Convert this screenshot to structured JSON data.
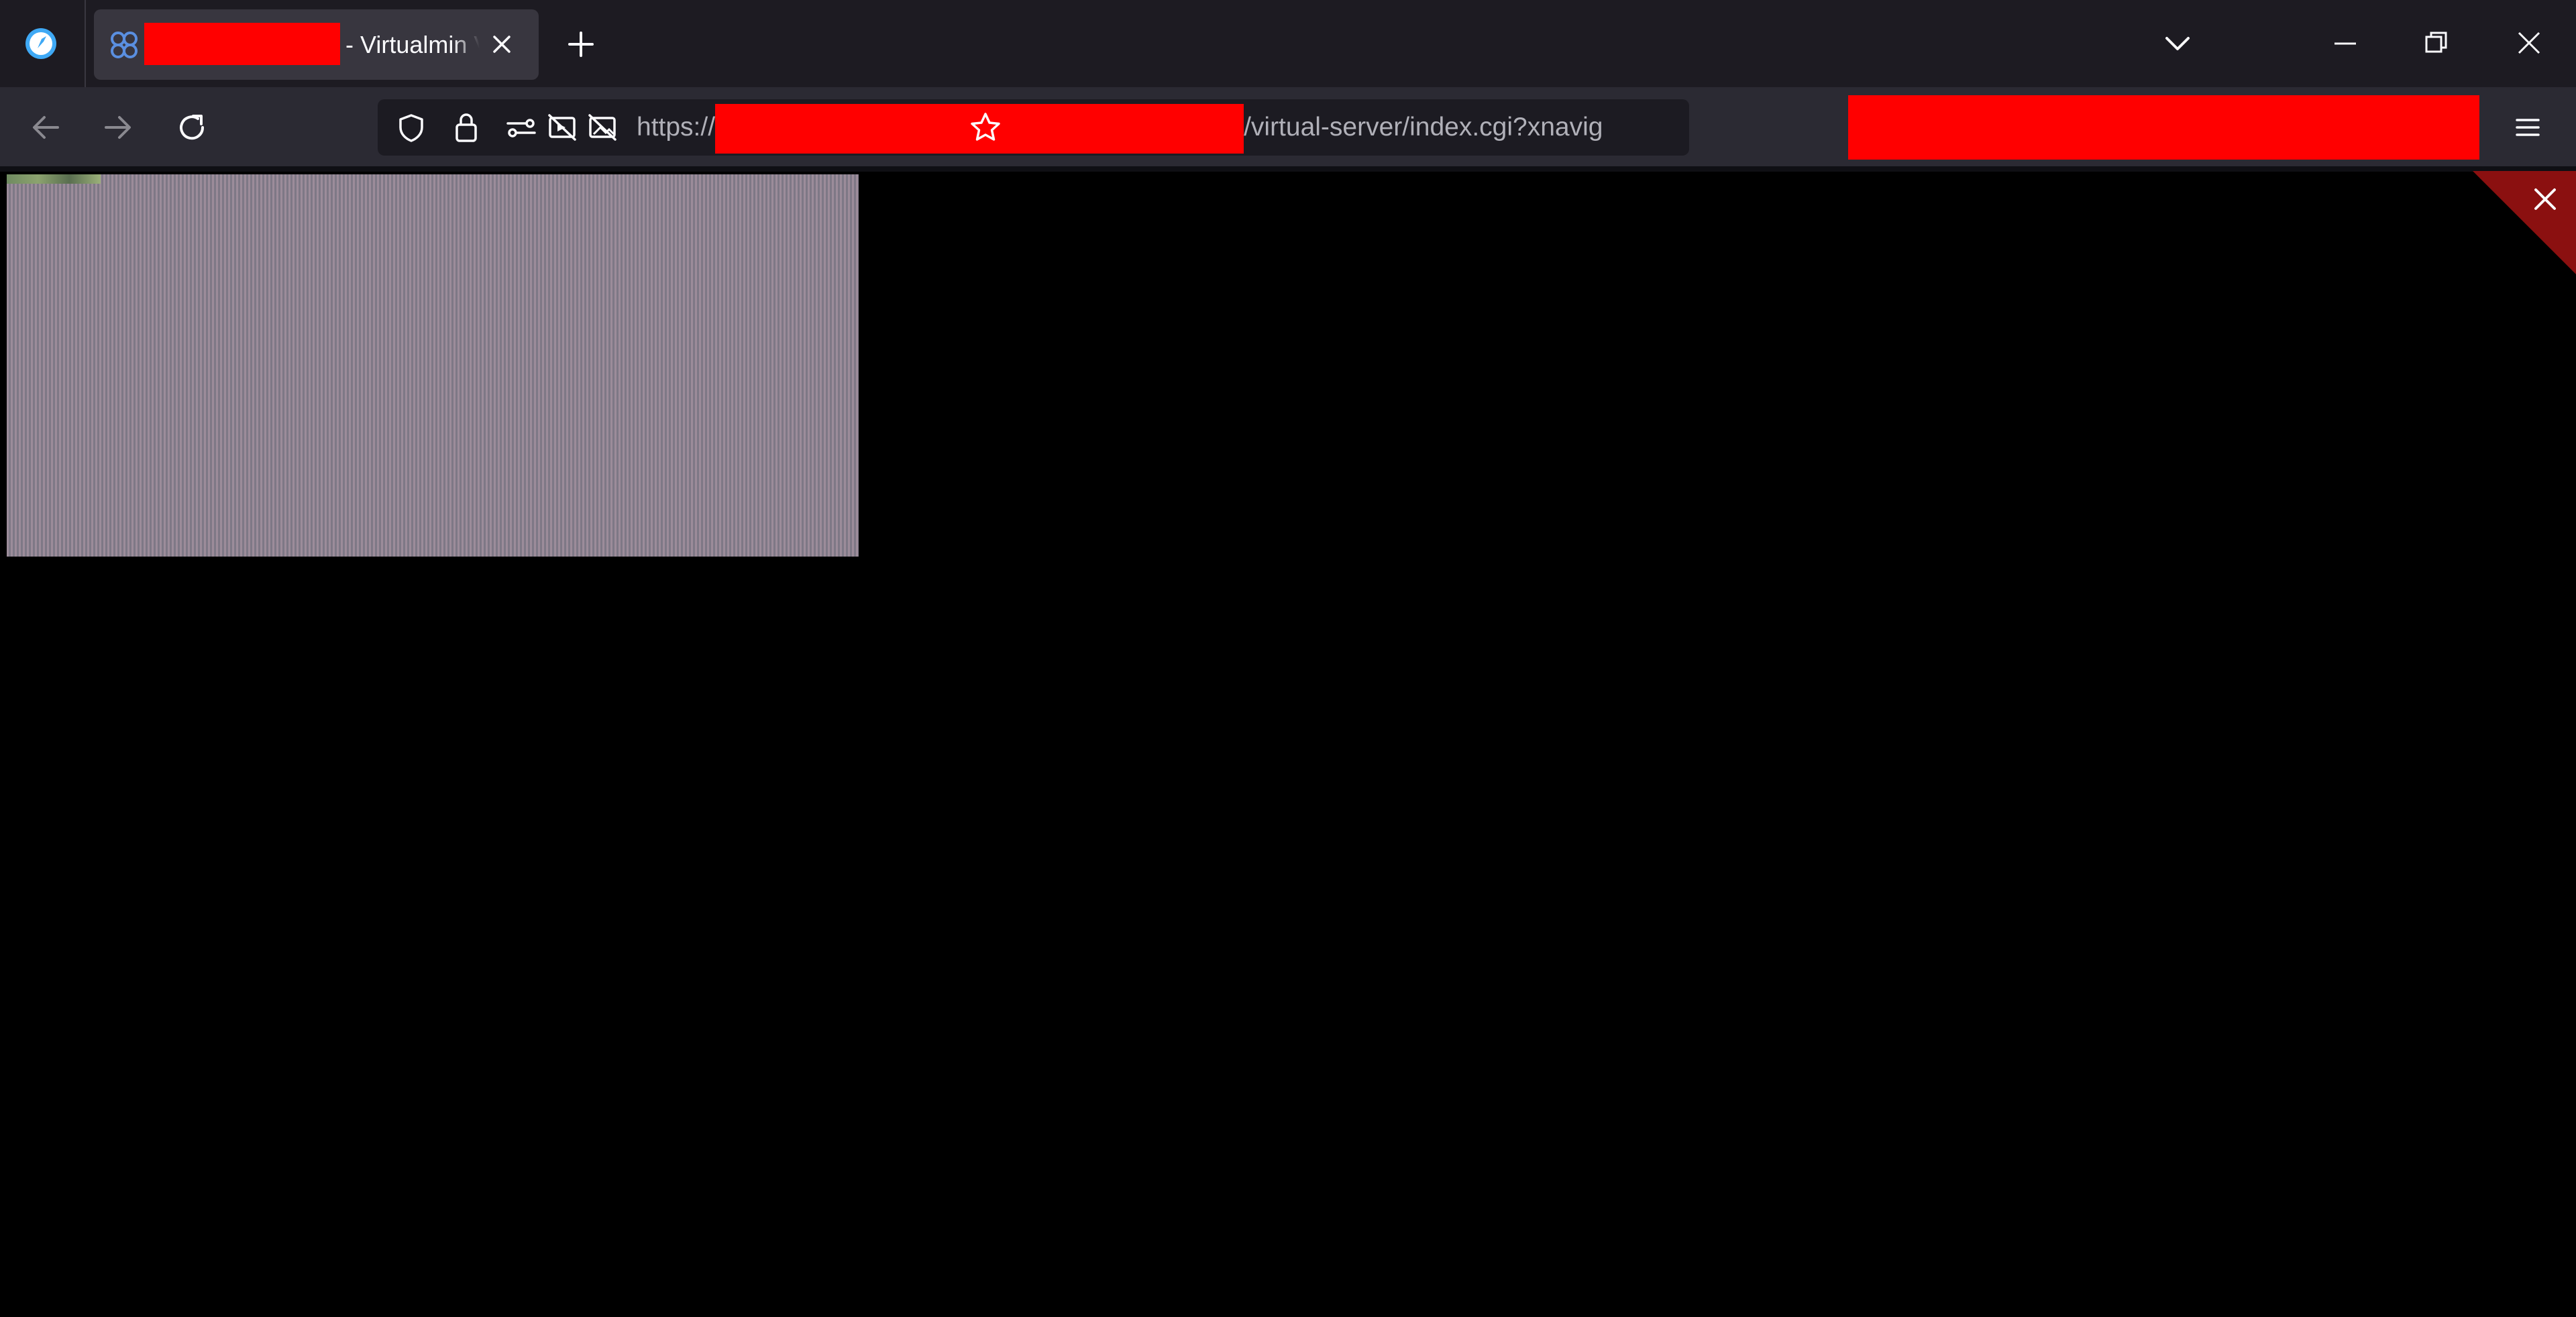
{
  "browser": {
    "tab": {
      "title_suffix": "- Virtualmin V",
      "close_icon": "close-icon",
      "favicon": "virtualmin-icon"
    },
    "new_tab_icon": "plus-icon",
    "list_tabs_icon": "chevron-down-icon",
    "window_controls": {
      "minimize_icon": "minimize-icon",
      "restore_icon": "restore-icon",
      "close_icon": "close-icon"
    },
    "nav": {
      "back_icon": "back-arrow-icon",
      "forward_icon": "forward-arrow-icon",
      "reload_icon": "reload-icon"
    },
    "url": {
      "scheme": "https://",
      "path": "/virtual-server/index.cgi?xnavig"
    },
    "urlbar_icons": [
      "shield-icon",
      "lock-icon",
      "permissions-icon",
      "blocked-autoplay-icon",
      "blocked-images-icon"
    ],
    "bookmark_icon": "star-icon",
    "menu_icon": "hamburger-menu-icon"
  },
  "colors": {
    "tabstrip_bg": "#1d1b22",
    "navbar_bg": "#2b2a33",
    "redaction": "#ff0000",
    "corner_close": "#8b1010"
  }
}
